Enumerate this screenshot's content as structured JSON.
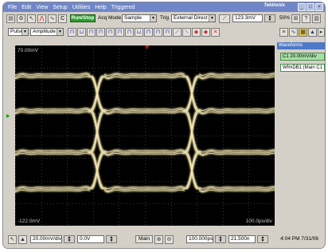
{
  "menu": {
    "items": [
      "File",
      "Edit",
      "View",
      "Setup",
      "Utilities",
      "Help",
      "Triggered"
    ],
    "brand": "Tektronix"
  },
  "toolbar1": {
    "run_stop_label": "Run/Stop",
    "acq_mode_label": "Acq Mode",
    "acq_mode_value": "Sample",
    "trig_label": "Trig",
    "trig_value": "External Direct",
    "trig_level": "123.3mV",
    "zoom": "50%"
  },
  "toolbar2": {
    "pulse_value": "Pulse",
    "amplitude_value": "Amplitude"
  },
  "scope": {
    "top_left_label": "70.00mV",
    "bottom_left_label": "-122.0mV",
    "bottom_right_label": "100.0ps/div"
  },
  "waveforms": {
    "header": "Waveforms",
    "items": [
      "C1 20.00mV/div",
      "WfmDB1 (Main C1"
    ]
  },
  "bottom": {
    "vert_scale": "20.00mV/div",
    "vert_offset": "0.0V",
    "main_label": "Main",
    "horiz_scale": "100.000ps",
    "horiz_pos": "21.500n",
    "clock": "4:04 PM 7/31/06"
  },
  "colors": {
    "trace": "#f4e8b0",
    "grid": "#6a6a6a",
    "run_stop": "#2c9b2c",
    "marker": "#00b000"
  }
}
